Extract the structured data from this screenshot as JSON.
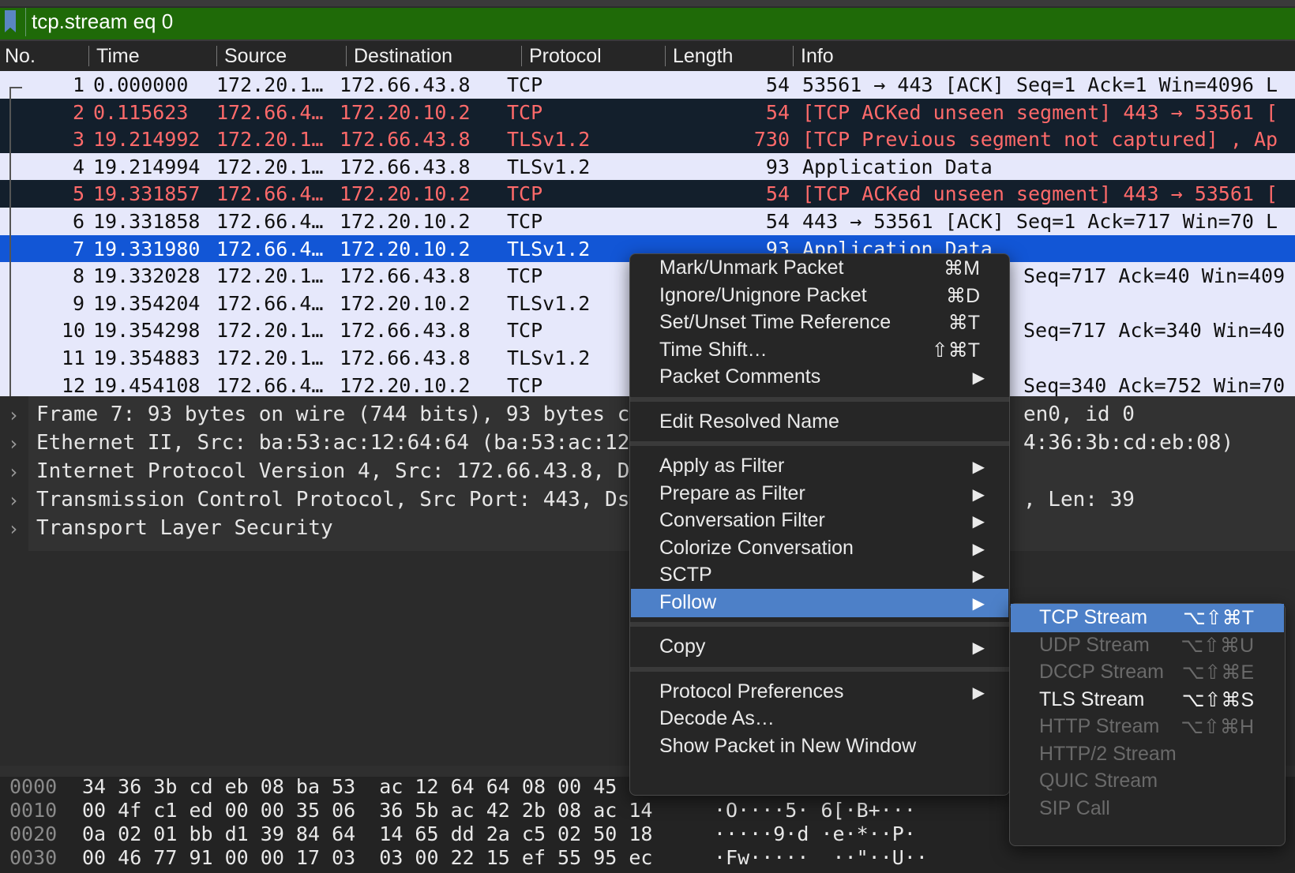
{
  "filter": {
    "text": "tcp.stream eq 0"
  },
  "columns": [
    "No.",
    "Time",
    "Source",
    "Destination",
    "Protocol",
    "Length",
    "Info"
  ],
  "packets": [
    {
      "no": "1",
      "time": "0.000000",
      "src": "172.20.1…",
      "dst": "172.66.43.8",
      "proto": "TCP",
      "len": "54",
      "info": "53561 → 443 [ACK] Seq=1 Ack=1 Win=4096 L",
      "style": "normal"
    },
    {
      "no": "2",
      "time": "0.115623",
      "src": "172.66.4…",
      "dst": "172.20.10.2",
      "proto": "TCP",
      "len": "54",
      "info": "[TCP ACKed unseen segment] 443 → 53561 [",
      "style": "dark"
    },
    {
      "no": "3",
      "time": "19.214992",
      "src": "172.20.1…",
      "dst": "172.66.43.8",
      "proto": "TLSv1.2",
      "len": "730",
      "info": "[TCP Previous segment not captured] , Ap",
      "style": "dark"
    },
    {
      "no": "4",
      "time": "19.214994",
      "src": "172.20.1…",
      "dst": "172.66.43.8",
      "proto": "TLSv1.2",
      "len": "93",
      "info": "Application Data",
      "style": "normal"
    },
    {
      "no": "5",
      "time": "19.331857",
      "src": "172.66.4…",
      "dst": "172.20.10.2",
      "proto": "TCP",
      "len": "54",
      "info": "[TCP ACKed unseen segment] 443 → 53561 [",
      "style": "dark"
    },
    {
      "no": "6",
      "time": "19.331858",
      "src": "172.66.4…",
      "dst": "172.20.10.2",
      "proto": "TCP",
      "len": "54",
      "info": "443 → 53561 [ACK] Seq=1 Ack=717 Win=70 L",
      "style": "normal"
    },
    {
      "no": "7",
      "time": "19.331980",
      "src": "172.66.4…",
      "dst": "172.20.10.2",
      "proto": "TLSv1.2",
      "len": "93",
      "info": "Application Data",
      "style": "sel"
    },
    {
      "no": "8",
      "time": "19.332028",
      "src": "172.20.1…",
      "dst": "172.66.43.8",
      "proto": "TCP",
      "len": "",
      "info": "Seq=717 Ack=40 Win=409",
      "style": "normal"
    },
    {
      "no": "9",
      "time": "19.354204",
      "src": "172.66.4…",
      "dst": "172.20.10.2",
      "proto": "TLSv1.2",
      "len": "",
      "info": "",
      "style": "normal"
    },
    {
      "no": "10",
      "time": "19.354298",
      "src": "172.20.1…",
      "dst": "172.66.43.8",
      "proto": "TCP",
      "len": "",
      "info": "Seq=717 Ack=340 Win=40",
      "style": "normal"
    },
    {
      "no": "11",
      "time": "19.354883",
      "src": "172.20.1…",
      "dst": "172.66.43.8",
      "proto": "TLSv1.2",
      "len": "",
      "info": "",
      "style": "normal"
    },
    {
      "no": "12",
      "time": "19.454108",
      "src": "172.66.4…",
      "dst": "172.20.10.2",
      "proto": "TCP",
      "len": "",
      "info": "Seq=340 Ack=752 Win=70",
      "style": "normal"
    }
  ],
  "details": [
    {
      "text": "Frame 7: 93 bytes on wire (744 bits), 93 bytes c",
      "tail": "en0, id 0"
    },
    {
      "text": "Ethernet II, Src: ba:53:ac:12:64:64 (ba:53:ac:12",
      "tail": "4:36:3b:cd:eb:08)"
    },
    {
      "text": "Internet Protocol Version 4, Src: 172.66.43.8, D",
      "tail": ""
    },
    {
      "text": "Transmission Control Protocol, Src Port: 443, Ds",
      "tail": ", Len: 39"
    },
    {
      "text": "Transport Layer Security",
      "tail": ""
    }
  ],
  "hex": [
    {
      "offset": "0000",
      "bytes": "34 36 3b cd eb 08 ba 53  ac 12 64 64 08 00 45 00",
      "ascii": ""
    },
    {
      "offset": "0010",
      "bytes": "00 4f c1 ed 00 00 35 06  36 5b ac 42 2b 08 ac 14",
      "ascii": "·O····5· 6[·B+···"
    },
    {
      "offset": "0020",
      "bytes": "0a 02 01 bb d1 39 84 64  14 65 dd 2a c5 02 50 18",
      "ascii": "·····9·d ·e·*··P·"
    },
    {
      "offset": "0030",
      "bytes": "00 46 77 91 00 00 17 03  03 00 22 15 ef 55 95 ec",
      "ascii": "·Fw·····  ··\"··U··"
    }
  ],
  "context_menu": {
    "groups": [
      [
        {
          "label": "Mark/Unmark Packet",
          "shortcut": "⌘M",
          "submenu": false
        },
        {
          "label": "Ignore/Unignore Packet",
          "shortcut": "⌘D",
          "submenu": false
        },
        {
          "label": "Set/Unset Time Reference",
          "shortcut": "⌘T",
          "submenu": false
        },
        {
          "label": "Time Shift…",
          "shortcut": "⇧⌘T",
          "submenu": false
        },
        {
          "label": "Packet Comments",
          "shortcut": "",
          "submenu": true
        }
      ],
      [
        {
          "label": "Edit Resolved Name",
          "shortcut": "",
          "submenu": false
        }
      ],
      [
        {
          "label": "Apply as Filter",
          "shortcut": "",
          "submenu": true
        },
        {
          "label": "Prepare as Filter",
          "shortcut": "",
          "submenu": true
        },
        {
          "label": "Conversation Filter",
          "shortcut": "",
          "submenu": true
        },
        {
          "label": "Colorize Conversation",
          "shortcut": "",
          "submenu": true
        },
        {
          "label": "SCTP",
          "shortcut": "",
          "submenu": true
        },
        {
          "label": "Follow",
          "shortcut": "",
          "submenu": true,
          "highlighted": true
        }
      ],
      [
        {
          "label": "Copy",
          "shortcut": "",
          "submenu": true
        }
      ],
      [
        {
          "label": "Protocol Preferences",
          "shortcut": "",
          "submenu": true
        },
        {
          "label": "Decode As…",
          "shortcut": "",
          "submenu": false
        },
        {
          "label": "Show Packet in New Window",
          "shortcut": "",
          "submenu": false
        }
      ]
    ]
  },
  "follow_submenu": [
    {
      "label": "TCP Stream",
      "shortcut": "⌥⇧⌘T",
      "enabled": true,
      "highlighted": true
    },
    {
      "label": "UDP Stream",
      "shortcut": "⌥⇧⌘U",
      "enabled": false
    },
    {
      "label": "DCCP Stream",
      "shortcut": "⌥⇧⌘E",
      "enabled": false
    },
    {
      "label": "TLS Stream",
      "shortcut": "⌥⇧⌘S",
      "enabled": true
    },
    {
      "label": "HTTP Stream",
      "shortcut": "⌥⇧⌘H",
      "enabled": false
    },
    {
      "label": "HTTP/2 Stream",
      "shortcut": "",
      "enabled": false
    },
    {
      "label": "QUIC Stream",
      "shortcut": "",
      "enabled": false
    },
    {
      "label": "SIP Call",
      "shortcut": "",
      "enabled": false
    }
  ],
  "colors": {
    "filter_valid": "#1f6a08",
    "selected": "#1256d6",
    "menu_highlight": "#4d80c8",
    "dark_row": "#131f2c",
    "dark_row_text": "#ff6a6a"
  }
}
